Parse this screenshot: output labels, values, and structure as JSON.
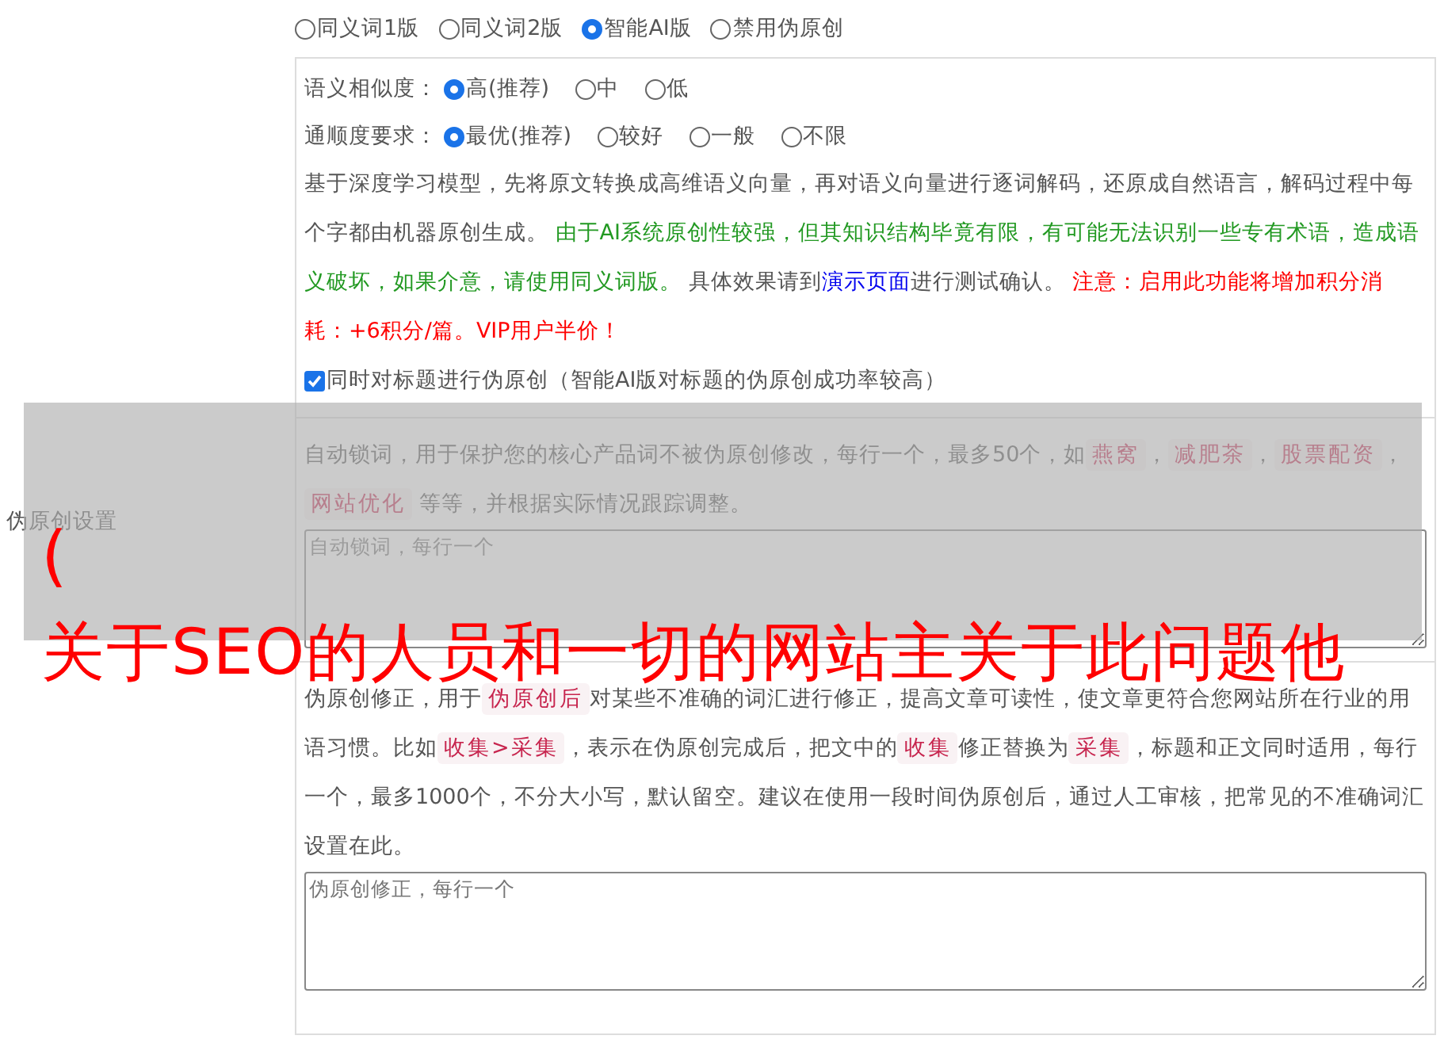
{
  "side_label": "伪原创设置",
  "mode_options": [
    {
      "label": "同义词1版",
      "selected": false
    },
    {
      "label": "同义词2版",
      "selected": false
    },
    {
      "label": "智能AI版",
      "selected": true
    },
    {
      "label": "禁用伪原创",
      "selected": false
    }
  ],
  "similarity": {
    "label": "语义相似度：",
    "options": [
      {
        "label": "高(推荐)",
        "selected": true
      },
      {
        "label": "中",
        "selected": false
      },
      {
        "label": "低",
        "selected": false
      }
    ]
  },
  "fluency": {
    "label": "通顺度要求：",
    "options": [
      {
        "label": "最优(推荐)",
        "selected": true
      },
      {
        "label": "较好",
        "selected": false
      },
      {
        "label": "一般",
        "selected": false
      },
      {
        "label": "不限",
        "selected": false
      }
    ]
  },
  "description": [
    {
      "kind": "plain",
      "text": "基于深度学习模型，先将原文转换成高维语义向量，再对语义向量进行逐词解码，还原成自然语言，解码过程中每个字都由机器原创生成。 "
    },
    {
      "kind": "green",
      "text": "由于AI系统原创性较强，但其知识结构毕竟有限，有可能无法识别一些专有术语，造成语义破坏，如果介意，请使用同义词版。"
    },
    {
      "kind": "plain",
      "text": " 具体效果请到"
    },
    {
      "kind": "link",
      "text": "演示页面"
    },
    {
      "kind": "plain",
      "text": "进行测试确认。 "
    },
    {
      "kind": "red",
      "text": "注意：启用此功能将增加积分消耗：+6积分/篇。VIP用户半价！"
    }
  ],
  "title_checkbox": {
    "label": "同时对标题进行伪原创（智能AI版对标题的伪原创成功率较高）",
    "checked": true
  },
  "lock_words": {
    "description": [
      {
        "kind": "plain",
        "text": "自动锁词，用于保护您的核心产品词不被伪原创修改，每行一个，最多50个，如"
      },
      {
        "kind": "code",
        "text": "燕窝"
      },
      {
        "kind": "plain",
        "text": "，"
      },
      {
        "kind": "code",
        "text": "减肥茶"
      },
      {
        "kind": "plain",
        "text": "，"
      },
      {
        "kind": "code",
        "text": "股票配资"
      },
      {
        "kind": "plain",
        "text": "，"
      },
      {
        "kind": "code",
        "text": "网站优化"
      },
      {
        "kind": "plain",
        "text": " 等等，并根据实际情况跟踪调整。"
      }
    ],
    "placeholder": "自动锁词，每行一个"
  },
  "corrections": {
    "description": [
      {
        "kind": "plain",
        "text": "伪原创修正，用于"
      },
      {
        "kind": "code",
        "text": "伪原创后"
      },
      {
        "kind": "plain",
        "text": "对某些不准确的词汇进行修正，提高文章可读性，使文章更符合您网站所在行业的用语习惯。比如"
      },
      {
        "kind": "code",
        "text": "收集>采集"
      },
      {
        "kind": "plain",
        "text": "，表示在伪原创完成后，把文中的"
      },
      {
        "kind": "code",
        "text": "收集"
      },
      {
        "kind": "plain",
        "text": "修正替换为"
      },
      {
        "kind": "code",
        "text": "采集"
      },
      {
        "kind": "plain",
        "text": "，标题和正文同时适用，每行一个，最多1000个，不分大小写，默认留空。建议在使用一段时间伪原创后，通过人工审核，把常见的不准确词汇设置在此。"
      }
    ],
    "placeholder": "伪原创修正，每行一个"
  },
  "overlay": {
    "bracket": "(",
    "caption": "关于SEO的人员和一切的网站主关于此问题他"
  }
}
